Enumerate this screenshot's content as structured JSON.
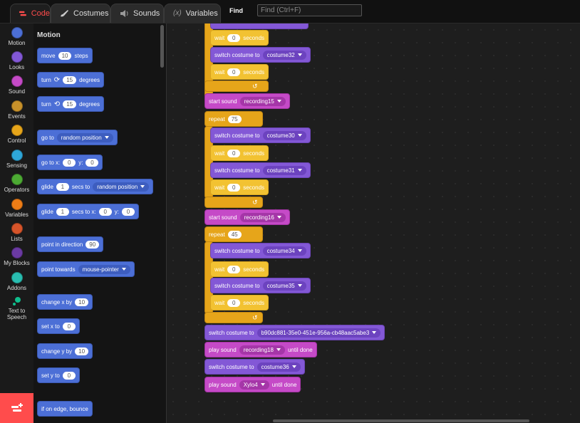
{
  "tabs": [
    {
      "label": "Code",
      "icon": "code-icon",
      "active": true
    },
    {
      "label": "Costumes",
      "icon": "brush-icon"
    },
    {
      "label": "Sounds",
      "icon": "speaker-icon"
    },
    {
      "label": "Variables",
      "icon": "variable-icon",
      "prefix": "(x)"
    }
  ],
  "find": {
    "label": "Find",
    "placeholder": "Find (Ctrl+F)"
  },
  "categories": [
    {
      "label": "Motion",
      "color": "#4c6fd6"
    },
    {
      "label": "Looks",
      "color": "#8358d6"
    },
    {
      "label": "Sound",
      "color": "#c54ac7"
    },
    {
      "label": "Events",
      "color": "#c8912a"
    },
    {
      "label": "Control",
      "color": "#e6a51a"
    },
    {
      "label": "Sensing",
      "color": "#2ea6d8"
    },
    {
      "label": "Operators",
      "color": "#4caa33"
    },
    {
      "label": "Variables",
      "color": "#ee7d16"
    },
    {
      "label": "Lists",
      "color": "#d6542a"
    },
    {
      "label": "My Blocks",
      "color": "#6b3aa3"
    },
    {
      "label": "Addons",
      "color": "#29bdb0"
    },
    {
      "label": "Text to Speech",
      "color": "#0fbd8c"
    }
  ],
  "palette": {
    "title": "Motion",
    "blocks": {
      "move": {
        "a": "move",
        "v": "10",
        "b": "steps"
      },
      "turn_right": {
        "a": "turn",
        "v": "15",
        "b": "degrees"
      },
      "turn_left": {
        "a": "turn",
        "v": "15",
        "b": "degrees"
      },
      "goto": {
        "a": "go to",
        "d": "random position"
      },
      "goto_xy": {
        "a": "go to x:",
        "x": "0",
        "b": "y:",
        "y": "0"
      },
      "glide_to": {
        "a": "glide",
        "v": "1",
        "b": "secs to",
        "d": "random position"
      },
      "glide_xy": {
        "a": "glide",
        "v": "1",
        "b": "secs to x:",
        "x": "0",
        "c": "y:",
        "y": "0"
      },
      "point_dir": {
        "a": "point in direction",
        "v": "90"
      },
      "point_towards": {
        "a": "point towards",
        "d": "mouse-pointer"
      },
      "change_x": {
        "a": "change x by",
        "v": "10"
      },
      "set_x": {
        "a": "set x to",
        "v": "0"
      },
      "change_y": {
        "a": "change y by",
        "v": "10"
      },
      "set_y": {
        "a": "set y to",
        "v": "0"
      },
      "bounce": {
        "a": "if on edge, bounce"
      }
    }
  },
  "script": {
    "b1": {
      "a": "wait",
      "v": "0",
      "b": "seconds"
    },
    "b2": {
      "a": "switch costume to",
      "d": "costume32"
    },
    "b3": {
      "a": "wait",
      "v": "0",
      "b": "seconds"
    },
    "b4": {
      "a": "start sound",
      "d": "recording15"
    },
    "b5": {
      "a": "repeat",
      "v": "75"
    },
    "b6": {
      "a": "switch costume to",
      "d": "costume30"
    },
    "b7": {
      "a": "wait",
      "v": "0",
      "b": "seconds"
    },
    "b8": {
      "a": "switch costume to",
      "d": "costume31"
    },
    "b9": {
      "a": "wait",
      "v": "0",
      "b": "seconds"
    },
    "b10": {
      "a": "start sound",
      "d": "recording16"
    },
    "b11": {
      "a": "repeat",
      "v": "45"
    },
    "b12": {
      "a": "switch costume to",
      "d": "costume34"
    },
    "b13": {
      "a": "wait",
      "v": "0",
      "b": "seconds"
    },
    "b14": {
      "a": "switch costume to",
      "d": "costume35"
    },
    "b15": {
      "a": "wait",
      "v": "0",
      "b": "seconds"
    },
    "b16": {
      "a": "switch costume to",
      "d": "b90dc881-35e0-451e-956a-cb48aac5abe3"
    },
    "b17": {
      "a": "play sound",
      "d": "recording18",
      "b": "until done"
    },
    "b18": {
      "a": "switch costume to",
      "d": "costume36"
    },
    "b19": {
      "a": "play sound",
      "d": "Xylo4",
      "b": "until done"
    }
  }
}
